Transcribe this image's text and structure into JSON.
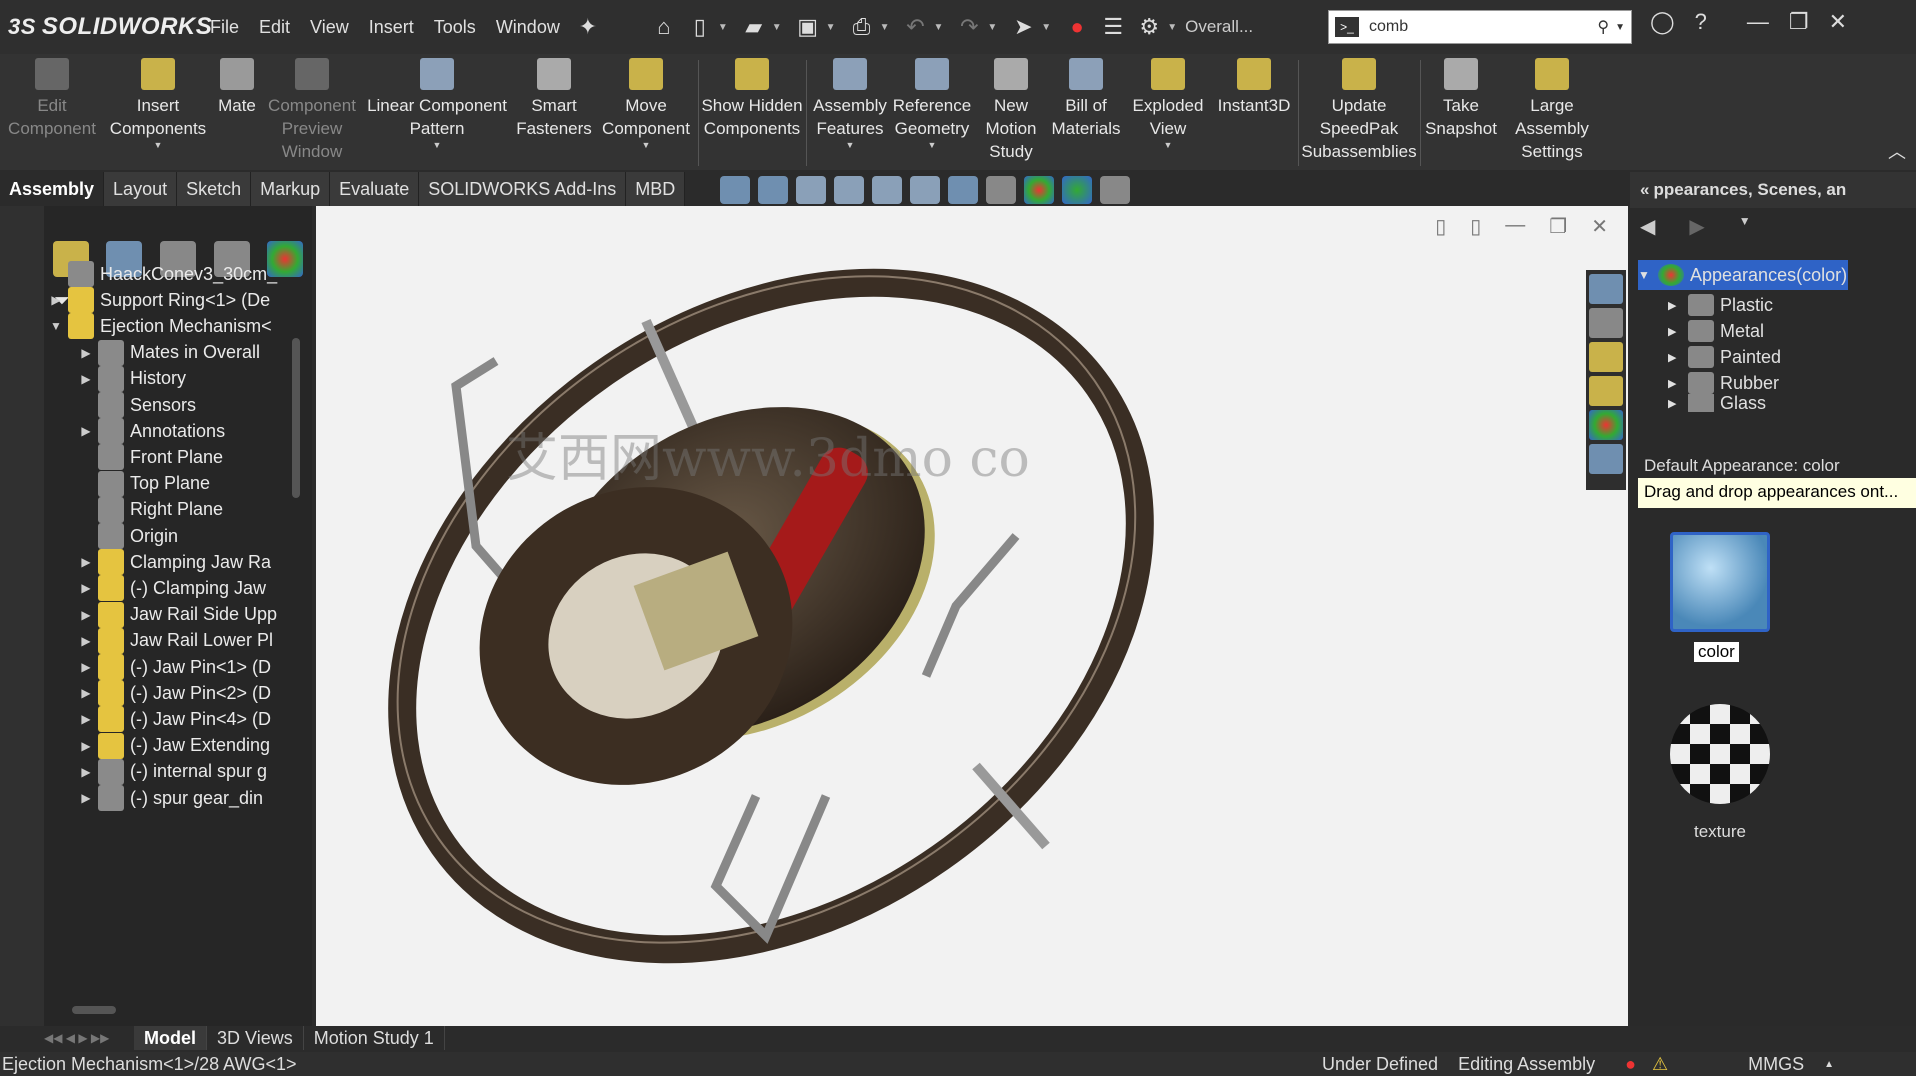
{
  "app": {
    "name": "SOLIDWORKS",
    "doc_title": "Overall..."
  },
  "menu": [
    "File",
    "Edit",
    "View",
    "Insert",
    "Tools",
    "Window"
  ],
  "search": {
    "value": "comb"
  },
  "ribbon": [
    {
      "label": "Edit Component",
      "enabled": false
    },
    {
      "label": "Insert Components",
      "enabled": true
    },
    {
      "label": "Mate",
      "enabled": true
    },
    {
      "label": "Component Preview Window",
      "enabled": false
    },
    {
      "label": "Linear Component Pattern",
      "enabled": true
    },
    {
      "label": "Smart Fasteners",
      "enabled": true
    },
    {
      "label": "Move Component",
      "enabled": true
    },
    {
      "label": "Show Hidden Components",
      "enabled": true
    },
    {
      "label": "Assembly Features",
      "enabled": true
    },
    {
      "label": "Reference Geometry",
      "enabled": true
    },
    {
      "label": "New Motion Study",
      "enabled": true
    },
    {
      "label": "Bill of Materials",
      "enabled": true
    },
    {
      "label": "Exploded View",
      "enabled": true
    },
    {
      "label": "Instant3D",
      "enabled": true
    },
    {
      "label": "Update SpeedPak Subassemblies",
      "enabled": true
    },
    {
      "label": "Take Snapshot",
      "enabled": true
    },
    {
      "label": "Large Assembly Settings",
      "enabled": true
    }
  ],
  "tabs": [
    "Assembly",
    "Layout",
    "Sketch",
    "Markup",
    "Evaluate",
    "SOLIDWORKS Add-Ins",
    "MBD"
  ],
  "tree": [
    {
      "label": "HaackConev3_30cm_",
      "indent": 0,
      "arrow": "",
      "icon": "part"
    },
    {
      "label": "Support Ring<1> (De",
      "indent": 0,
      "arrow": "▶",
      "icon": "asm"
    },
    {
      "label": "Ejection Mechanism<",
      "indent": 0,
      "arrow": "▼",
      "icon": "asm"
    },
    {
      "label": "Mates in Overall",
      "indent": 1,
      "arrow": "▶",
      "icon": "mates"
    },
    {
      "label": "History",
      "indent": 1,
      "arrow": "▶",
      "icon": "history"
    },
    {
      "label": "Sensors",
      "indent": 1,
      "arrow": "",
      "icon": "sensor"
    },
    {
      "label": "Annotations",
      "indent": 1,
      "arrow": "▶",
      "icon": "annot"
    },
    {
      "label": "Front Plane",
      "indent": 1,
      "arrow": "",
      "icon": "plane"
    },
    {
      "label": "Top Plane",
      "indent": 1,
      "arrow": "",
      "icon": "plane"
    },
    {
      "label": "Right Plane",
      "indent": 1,
      "arrow": "",
      "icon": "plane"
    },
    {
      "label": "Origin",
      "indent": 1,
      "arrow": "",
      "icon": "origin"
    },
    {
      "label": "Clamping Jaw Ra",
      "indent": 1,
      "arrow": "▶",
      "icon": "asm"
    },
    {
      "label": "(-) Clamping Jaw",
      "indent": 1,
      "arrow": "▶",
      "icon": "asm"
    },
    {
      "label": "Jaw Rail Side Upp",
      "indent": 1,
      "arrow": "▶",
      "icon": "asm"
    },
    {
      "label": "Jaw Rail Lower Pl",
      "indent": 1,
      "arrow": "▶",
      "icon": "asm"
    },
    {
      "label": "(-) Jaw Pin<1> (D",
      "indent": 1,
      "arrow": "▶",
      "icon": "asm"
    },
    {
      "label": "(-) Jaw Pin<2> (D",
      "indent": 1,
      "arrow": "▶",
      "icon": "asm"
    },
    {
      "label": "(-) Jaw Pin<4> (D",
      "indent": 1,
      "arrow": "▶",
      "icon": "asm"
    },
    {
      "label": "(-) Jaw Extending",
      "indent": 1,
      "arrow": "▶",
      "icon": "asm"
    },
    {
      "label": "(-) internal spur g",
      "indent": 1,
      "arrow": "▶",
      "icon": "gear"
    },
    {
      "label": "(-) spur gear_din",
      "indent": 1,
      "arrow": "▶",
      "icon": "gear"
    }
  ],
  "taskpane": {
    "title": "ppearances, Scenes, an",
    "root": "Appearances(color)",
    "items": [
      "Plastic",
      "Metal",
      "Painted",
      "Rubber",
      "Glass"
    ],
    "default_label": "Default Appearance: color",
    "hint": "Drag and drop appearances ont...",
    "thumbs": [
      "color",
      "texture"
    ]
  },
  "bottom_tabs": [
    "Model",
    "3D Views",
    "Motion Study 1"
  ],
  "status": {
    "left": "Ejection Mechanism<1>/28 AWG<1>",
    "define": "Under Defined",
    "mode": "Editing Assembly",
    "units": "MMGS"
  },
  "watermark": "艾西网www.3dmo   co",
  "colors": {
    "accent": "#2f63c6",
    "ribbon_bg": "#333333",
    "viewport_bg": "#f2f2f2"
  }
}
